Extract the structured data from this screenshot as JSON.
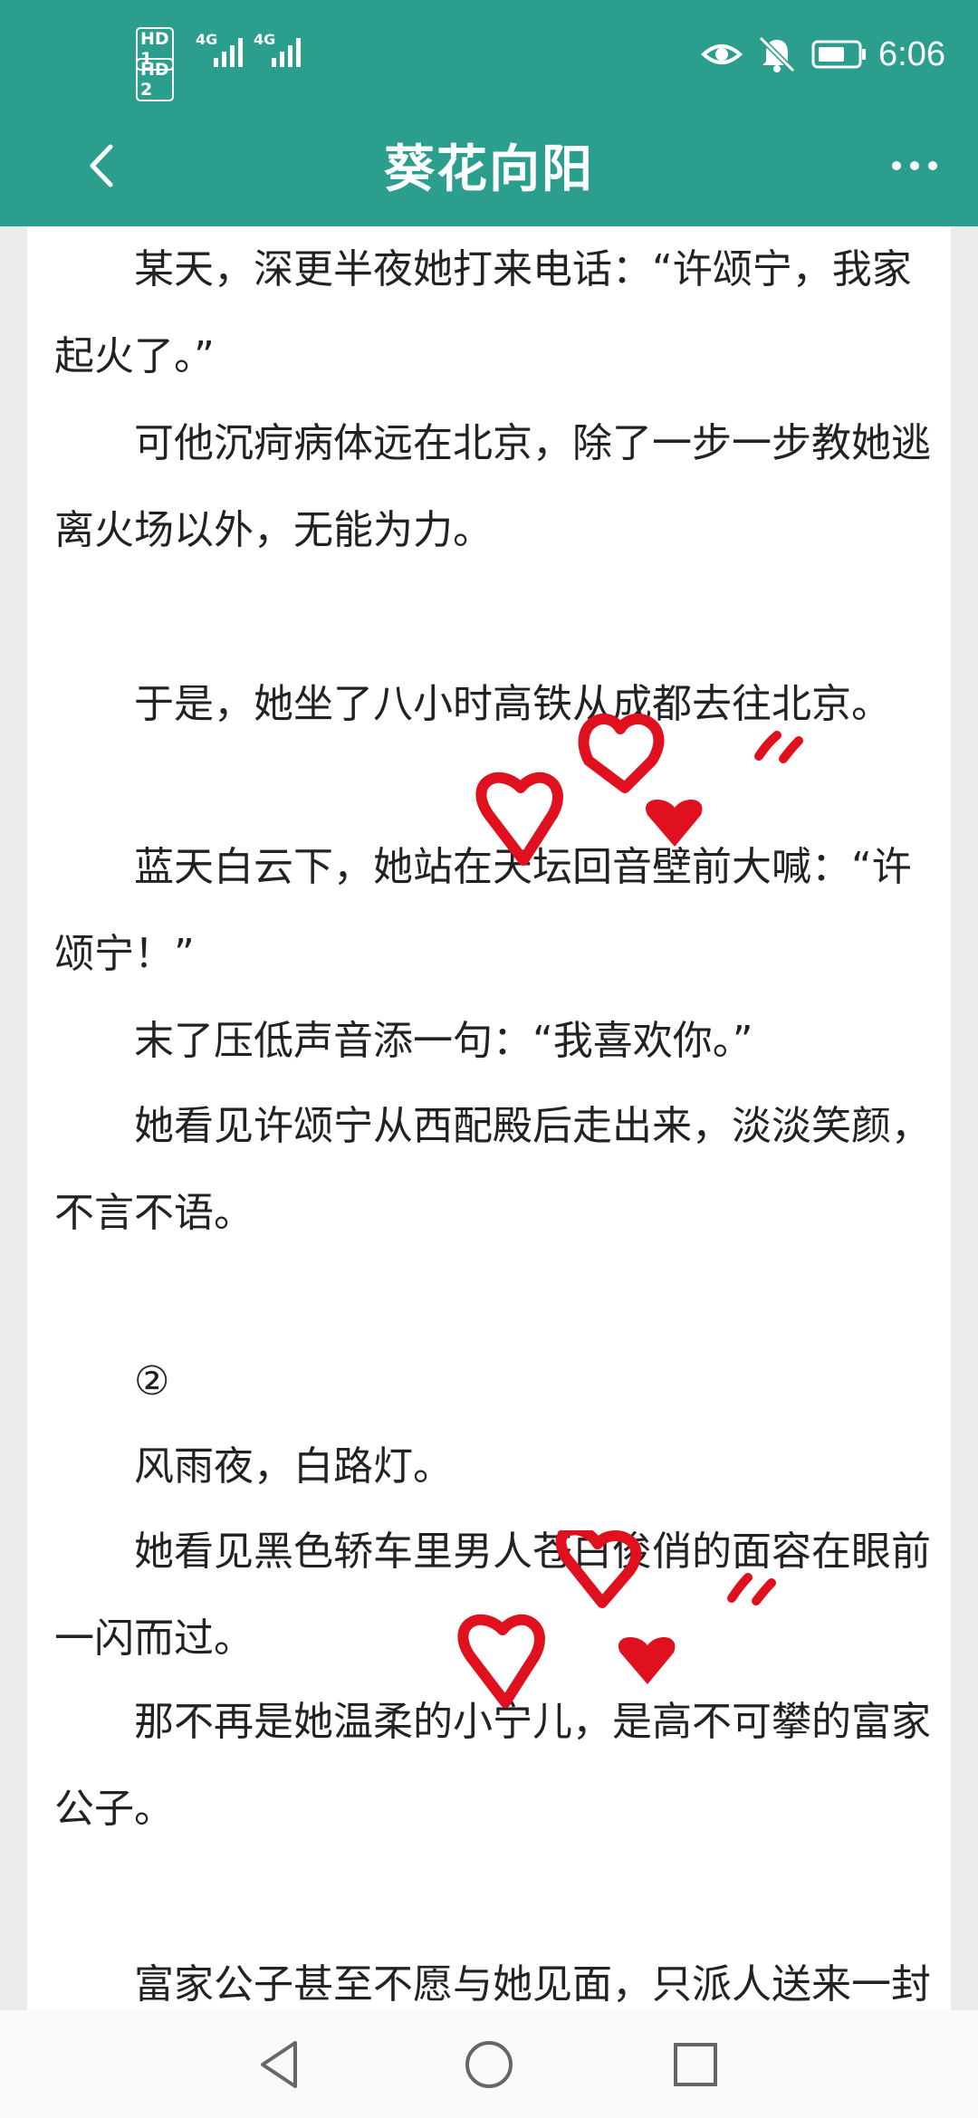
{
  "status_bar": {
    "sim1": "HD 1",
    "sim2": "HD 2",
    "net1": "4G",
    "net2": "4G",
    "time": "6:06",
    "icons": [
      "eye-icon",
      "bell-muted-icon",
      "battery-icon"
    ]
  },
  "app_bar": {
    "title": "葵花向阳",
    "back_icon": "chevron-left-icon",
    "more_icon": "more-dots-icon"
  },
  "article": {
    "paragraphs": [
      "某天，深更半夜她打来电话：“许颂宁，我家起火了。”",
      "可他沉疴病体远在北京，除了一步一步教她逃离火场以外，无能为力。",
      "于是，她坐了八小时高铁从成都去往北京。",
      "蓝天白云下，她站在天坛回音壁前大喊：“许颂宁！”",
      "末了压低声音添一句：“我喜欢你。”",
      "她看见许颂宁从西配殿后走出来，淡淡笑颜，不言不语。",
      "②",
      "风雨夜，白路灯。",
      "她看见黑色轿车里男人苍白俊俏的面容在眼前一闪而过。",
      "那不再是她温柔的小宁儿，是高不可攀的富家公子。",
      "富家公子甚至不愿与她见面，只派人送来一封"
    ]
  },
  "nav_bar": {
    "icons": [
      "back-triangle-icon",
      "home-circle-icon",
      "recents-square-icon"
    ]
  },
  "colors": {
    "accent": "#2c9e8d",
    "heart": "#e0101e"
  }
}
